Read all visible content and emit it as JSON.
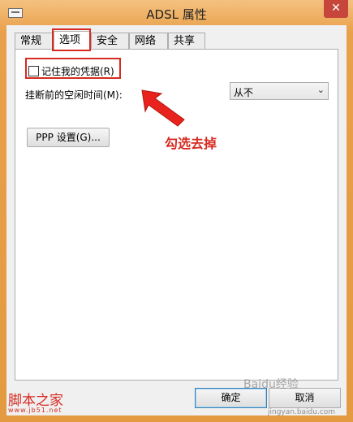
{
  "window": {
    "title": "ADSL 属性",
    "close_glyph": "✕"
  },
  "tabs": [
    {
      "label": "常规",
      "selected": false
    },
    {
      "label": "选项",
      "selected": true
    },
    {
      "label": "安全",
      "selected": false
    },
    {
      "label": "网络",
      "selected": false
    },
    {
      "label": "共享",
      "selected": false
    }
  ],
  "options": {
    "remember_credentials": {
      "label": "记住我的凭据(R)",
      "checked": false
    },
    "idle_time_label": "挂断前的空闲时间(M):",
    "idle_time_value": "从不",
    "ppp_button_label": "PPP 设置(G)..."
  },
  "annotation": {
    "text": "勾选去掉",
    "color": "#d62b21"
  },
  "footer": {
    "ok_label": "确定",
    "cancel_label": "取消"
  },
  "watermarks": {
    "left_text": "脚本之家",
    "left_url": "www.jb51.net",
    "right_text": "Baidu经验",
    "right_sub": "jingyan.baidu.com"
  },
  "colors": {
    "accent_red": "#d62b21",
    "title_bar": "#e9a04a"
  }
}
